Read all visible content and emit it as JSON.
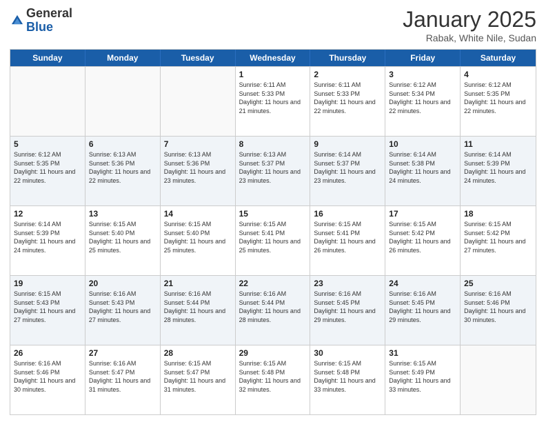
{
  "header": {
    "logo": {
      "line1": "General",
      "line2": "Blue"
    },
    "title": "January 2025",
    "subtitle": "Rabak, White Nile, Sudan"
  },
  "days_of_week": [
    "Sunday",
    "Monday",
    "Tuesday",
    "Wednesday",
    "Thursday",
    "Friday",
    "Saturday"
  ],
  "weeks": [
    {
      "alt": false,
      "days": [
        {
          "num": "",
          "sunrise": "",
          "sunset": "",
          "daylight": ""
        },
        {
          "num": "",
          "sunrise": "",
          "sunset": "",
          "daylight": ""
        },
        {
          "num": "",
          "sunrise": "",
          "sunset": "",
          "daylight": ""
        },
        {
          "num": "1",
          "sunrise": "Sunrise: 6:11 AM",
          "sunset": "Sunset: 5:33 PM",
          "daylight": "Daylight: 11 hours and 21 minutes."
        },
        {
          "num": "2",
          "sunrise": "Sunrise: 6:11 AM",
          "sunset": "Sunset: 5:33 PM",
          "daylight": "Daylight: 11 hours and 22 minutes."
        },
        {
          "num": "3",
          "sunrise": "Sunrise: 6:12 AM",
          "sunset": "Sunset: 5:34 PM",
          "daylight": "Daylight: 11 hours and 22 minutes."
        },
        {
          "num": "4",
          "sunrise": "Sunrise: 6:12 AM",
          "sunset": "Sunset: 5:35 PM",
          "daylight": "Daylight: 11 hours and 22 minutes."
        }
      ]
    },
    {
      "alt": true,
      "days": [
        {
          "num": "5",
          "sunrise": "Sunrise: 6:12 AM",
          "sunset": "Sunset: 5:35 PM",
          "daylight": "Daylight: 11 hours and 22 minutes."
        },
        {
          "num": "6",
          "sunrise": "Sunrise: 6:13 AM",
          "sunset": "Sunset: 5:36 PM",
          "daylight": "Daylight: 11 hours and 22 minutes."
        },
        {
          "num": "7",
          "sunrise": "Sunrise: 6:13 AM",
          "sunset": "Sunset: 5:36 PM",
          "daylight": "Daylight: 11 hours and 23 minutes."
        },
        {
          "num": "8",
          "sunrise": "Sunrise: 6:13 AM",
          "sunset": "Sunset: 5:37 PM",
          "daylight": "Daylight: 11 hours and 23 minutes."
        },
        {
          "num": "9",
          "sunrise": "Sunrise: 6:14 AM",
          "sunset": "Sunset: 5:37 PM",
          "daylight": "Daylight: 11 hours and 23 minutes."
        },
        {
          "num": "10",
          "sunrise": "Sunrise: 6:14 AM",
          "sunset": "Sunset: 5:38 PM",
          "daylight": "Daylight: 11 hours and 24 minutes."
        },
        {
          "num": "11",
          "sunrise": "Sunrise: 6:14 AM",
          "sunset": "Sunset: 5:39 PM",
          "daylight": "Daylight: 11 hours and 24 minutes."
        }
      ]
    },
    {
      "alt": false,
      "days": [
        {
          "num": "12",
          "sunrise": "Sunrise: 6:14 AM",
          "sunset": "Sunset: 5:39 PM",
          "daylight": "Daylight: 11 hours and 24 minutes."
        },
        {
          "num": "13",
          "sunrise": "Sunrise: 6:15 AM",
          "sunset": "Sunset: 5:40 PM",
          "daylight": "Daylight: 11 hours and 25 minutes."
        },
        {
          "num": "14",
          "sunrise": "Sunrise: 6:15 AM",
          "sunset": "Sunset: 5:40 PM",
          "daylight": "Daylight: 11 hours and 25 minutes."
        },
        {
          "num": "15",
          "sunrise": "Sunrise: 6:15 AM",
          "sunset": "Sunset: 5:41 PM",
          "daylight": "Daylight: 11 hours and 25 minutes."
        },
        {
          "num": "16",
          "sunrise": "Sunrise: 6:15 AM",
          "sunset": "Sunset: 5:41 PM",
          "daylight": "Daylight: 11 hours and 26 minutes."
        },
        {
          "num": "17",
          "sunrise": "Sunrise: 6:15 AM",
          "sunset": "Sunset: 5:42 PM",
          "daylight": "Daylight: 11 hours and 26 minutes."
        },
        {
          "num": "18",
          "sunrise": "Sunrise: 6:15 AM",
          "sunset": "Sunset: 5:42 PM",
          "daylight": "Daylight: 11 hours and 27 minutes."
        }
      ]
    },
    {
      "alt": true,
      "days": [
        {
          "num": "19",
          "sunrise": "Sunrise: 6:15 AM",
          "sunset": "Sunset: 5:43 PM",
          "daylight": "Daylight: 11 hours and 27 minutes."
        },
        {
          "num": "20",
          "sunrise": "Sunrise: 6:16 AM",
          "sunset": "Sunset: 5:43 PM",
          "daylight": "Daylight: 11 hours and 27 minutes."
        },
        {
          "num": "21",
          "sunrise": "Sunrise: 6:16 AM",
          "sunset": "Sunset: 5:44 PM",
          "daylight": "Daylight: 11 hours and 28 minutes."
        },
        {
          "num": "22",
          "sunrise": "Sunrise: 6:16 AM",
          "sunset": "Sunset: 5:44 PM",
          "daylight": "Daylight: 11 hours and 28 minutes."
        },
        {
          "num": "23",
          "sunrise": "Sunrise: 6:16 AM",
          "sunset": "Sunset: 5:45 PM",
          "daylight": "Daylight: 11 hours and 29 minutes."
        },
        {
          "num": "24",
          "sunrise": "Sunrise: 6:16 AM",
          "sunset": "Sunset: 5:45 PM",
          "daylight": "Daylight: 11 hours and 29 minutes."
        },
        {
          "num": "25",
          "sunrise": "Sunrise: 6:16 AM",
          "sunset": "Sunset: 5:46 PM",
          "daylight": "Daylight: 11 hours and 30 minutes."
        }
      ]
    },
    {
      "alt": false,
      "days": [
        {
          "num": "26",
          "sunrise": "Sunrise: 6:16 AM",
          "sunset": "Sunset: 5:46 PM",
          "daylight": "Daylight: 11 hours and 30 minutes."
        },
        {
          "num": "27",
          "sunrise": "Sunrise: 6:16 AM",
          "sunset": "Sunset: 5:47 PM",
          "daylight": "Daylight: 11 hours and 31 minutes."
        },
        {
          "num": "28",
          "sunrise": "Sunrise: 6:15 AM",
          "sunset": "Sunset: 5:47 PM",
          "daylight": "Daylight: 11 hours and 31 minutes."
        },
        {
          "num": "29",
          "sunrise": "Sunrise: 6:15 AM",
          "sunset": "Sunset: 5:48 PM",
          "daylight": "Daylight: 11 hours and 32 minutes."
        },
        {
          "num": "30",
          "sunrise": "Sunrise: 6:15 AM",
          "sunset": "Sunset: 5:48 PM",
          "daylight": "Daylight: 11 hours and 33 minutes."
        },
        {
          "num": "31",
          "sunrise": "Sunrise: 6:15 AM",
          "sunset": "Sunset: 5:49 PM",
          "daylight": "Daylight: 11 hours and 33 minutes."
        },
        {
          "num": "",
          "sunrise": "",
          "sunset": "",
          "daylight": ""
        }
      ]
    }
  ]
}
